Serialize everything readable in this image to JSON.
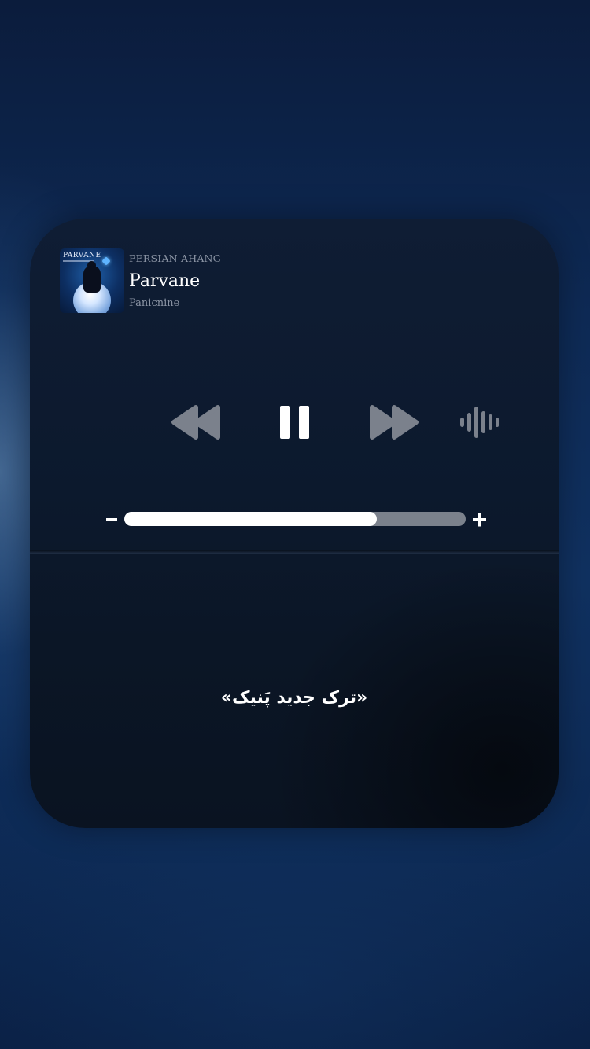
{
  "player": {
    "album_art_title": "PARVANE",
    "source": "PERSIAN AHANG",
    "track_title": "Parvane",
    "artist": "Panicnine",
    "volume_fraction": 0.74,
    "volume_minus_symbol": "-",
    "volume_plus_symbol": "+",
    "icons": {
      "rewind": "rewind-icon",
      "pause": "pause-icon",
      "forward": "fast-forward-icon",
      "audio": "audio-waveform-icon"
    },
    "colors": {
      "control_active": "#ffffff",
      "control_inactive": "#7b818c",
      "volume_track": "#7b818c",
      "volume_fill": "#ffffff"
    }
  },
  "caption": {
    "text": "«ترک جدید پَنیک»"
  }
}
